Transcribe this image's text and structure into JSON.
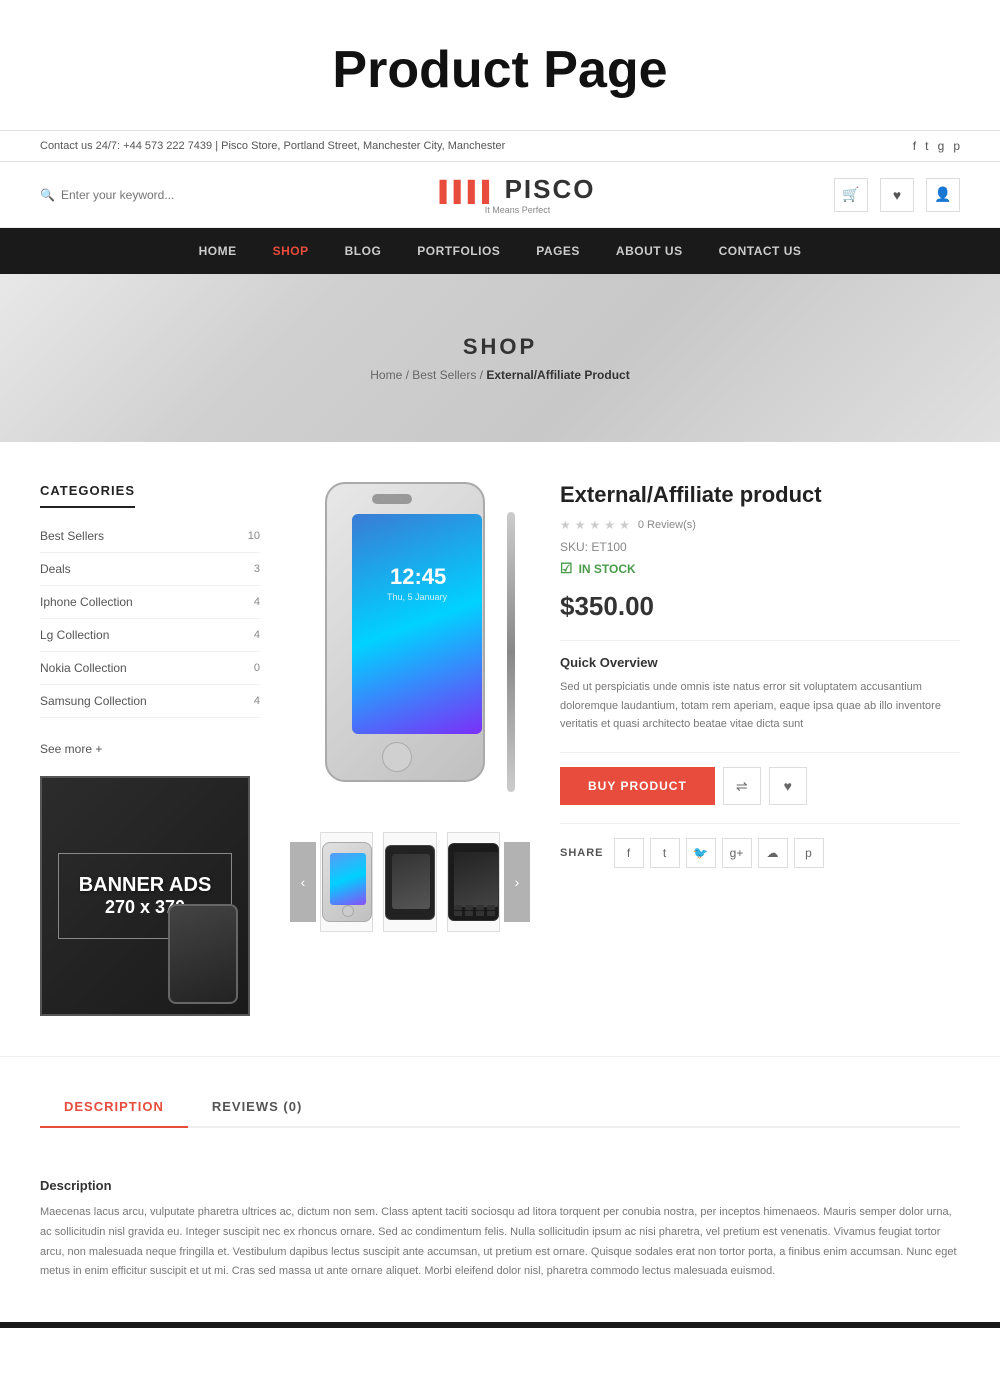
{
  "page": {
    "title": "Product Page"
  },
  "topbar": {
    "contact_text": "Contact us 24/7: +44 573 222 7439",
    "separator": "|",
    "address": "Pisco Store, Portland Street, Manchester City, Manchester"
  },
  "header": {
    "search_placeholder": "Enter your keyword...",
    "logo_bars": "▌▌▌▌",
    "logo_text": "PISCO",
    "logo_tagline": "It Means Perfect"
  },
  "nav": {
    "items": [
      {
        "label": "HOME",
        "active": false
      },
      {
        "label": "SHOP",
        "active": true
      },
      {
        "label": "BLOG",
        "active": false
      },
      {
        "label": "PORTFOLIOS",
        "active": false
      },
      {
        "label": "PAGES",
        "active": false
      },
      {
        "label": "ABOUT US",
        "active": false
      },
      {
        "label": "CONTACT US",
        "active": false
      }
    ]
  },
  "hero": {
    "title": "SHOP",
    "breadcrumb_home": "Home",
    "breadcrumb_sep1": "/",
    "breadcrumb_cat": "Best Sellers",
    "breadcrumb_sep2": "/",
    "breadcrumb_current": "External/Affiliate Product"
  },
  "sidebar": {
    "section_title": "CATEGORIES",
    "categories": [
      {
        "name": "Best Sellers",
        "count": 10
      },
      {
        "name": "Deals",
        "count": 3
      },
      {
        "name": "Iphone Collection",
        "count": 4
      },
      {
        "name": "Lg Collection",
        "count": 4
      },
      {
        "name": "Nokia Collection",
        "count": 0
      },
      {
        "name": "Samsung Collection",
        "count": 4
      }
    ],
    "see_more": "See more +",
    "banner_text": "BANNER ADS",
    "banner_size": "270 x 370"
  },
  "product": {
    "title": "External/Affiliate product",
    "review_count": "0 Review(s)",
    "sku_label": "SKU:",
    "sku_value": "ET100",
    "stock_label": "IN STOCK",
    "price": "$350.00",
    "overview_title": "Quick Overview",
    "overview_text": "Sed ut perspiciatis unde omnis iste natus error sit voluptatem accusantium doloremque laudantium, totam rem aperiam, eaque ipsa quae ab illo inventore veritatis et quasi architecto beatae vitae dicta sunt",
    "buy_btn": "BUY PRODUCT",
    "share_label": "SHARE"
  },
  "tabs": {
    "tab1_label": "DESCRIPTION",
    "tab2_label": "REVIEWS (0)",
    "desc_heading": "Description",
    "desc_text": "Maecenas lacus arcu, vulputate pharetra ultrices ac, dictum non sem. Class aptent taciti sociosqu ad litora torquent per conubia nostra, per inceptos himenaeos. Mauris semper dolor urna, ac sollicitudin nisl gravida eu. Integer suscipit nec ex rhoncus ornare. Sed ac condimentum felis. Nulla sollicitudin ipsum ac nisi pharetra, vel pretium est venenatis. Vivamus feugiat tortor arcu, non malesuada neque fringilla et. Vestibulum dapibus lectus suscipit ante accumsan, ut pretium est ornare. Quisque sodales erat non tortor porta, a finibus enim accumsan. Nunc eget metus in enim efficitur suscipit et ut mi. Cras sed massa ut ante ornare aliquet. Morbi eleifend dolor nisl, pharetra commodo lectus malesuada euismod."
  }
}
